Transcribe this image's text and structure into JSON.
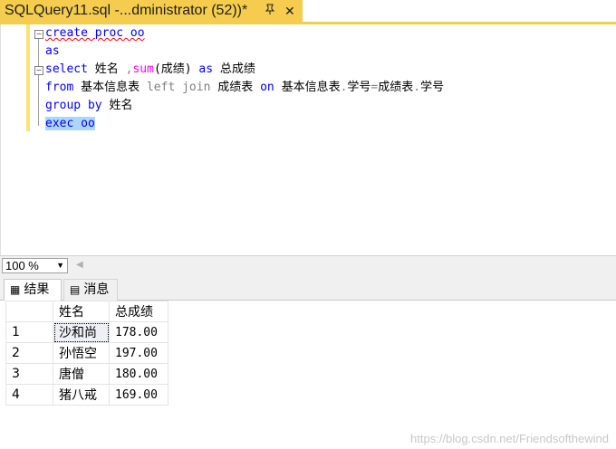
{
  "tab": {
    "title": "SQLQuery11.sql -...dministrator (52))*",
    "pin_icon": "pin-icon",
    "close_icon": "close-icon"
  },
  "editor": {
    "lines": [
      {
        "tokens": [
          [
            "kw",
            "create proc oo"
          ]
        ]
      },
      {
        "tokens": [
          [
            "kw",
            "as"
          ]
        ]
      },
      {
        "tokens": [
          [
            "kw",
            "select "
          ],
          [
            "txt",
            "姓名 "
          ],
          [
            "gray",
            ","
          ],
          [
            "fn",
            "sum"
          ],
          [
            "txt",
            "(成绩) "
          ],
          [
            "kw",
            "as "
          ],
          [
            "txt",
            "总成绩"
          ]
        ]
      },
      {
        "tokens": [
          [
            "kw",
            "from "
          ],
          [
            "txt",
            "基本信息表 "
          ],
          [
            "gray",
            "left join "
          ],
          [
            "txt",
            "成绩表 "
          ],
          [
            "kw",
            "on "
          ],
          [
            "txt",
            "基本信息表"
          ],
          [
            "gray",
            "."
          ],
          [
            "txt",
            "学号"
          ],
          [
            "gray",
            "="
          ],
          [
            "txt",
            "成绩表"
          ],
          [
            "gray",
            "."
          ],
          [
            "txt",
            "学号"
          ]
        ]
      },
      {
        "tokens": [
          [
            "kw",
            "group by "
          ],
          [
            "txt",
            "姓名"
          ]
        ]
      },
      {
        "tokens": [
          [
            "kw",
            "exec oo"
          ]
        ]
      }
    ]
  },
  "zoom": {
    "value": "100 %"
  },
  "results_tabs": {
    "results_label": "结果",
    "messages_label": "消息"
  },
  "grid": {
    "columns": [
      "姓名",
      "总成绩"
    ],
    "rows": [
      {
        "n": "1",
        "name": "沙和尚",
        "score": "178.00"
      },
      {
        "n": "2",
        "name": "孙悟空",
        "score": "197.00"
      },
      {
        "n": "3",
        "name": "唐僧",
        "score": "180.00"
      },
      {
        "n": "4",
        "name": "猪八戒",
        "score": "169.00"
      }
    ]
  },
  "watermark": "https://blog.csdn.net/Friendsofthewind",
  "colors": {
    "tab_accent": "#f5cc4d",
    "keyword": "#0000ff",
    "function": "#ff00ff",
    "selection": "#add6ff"
  }
}
